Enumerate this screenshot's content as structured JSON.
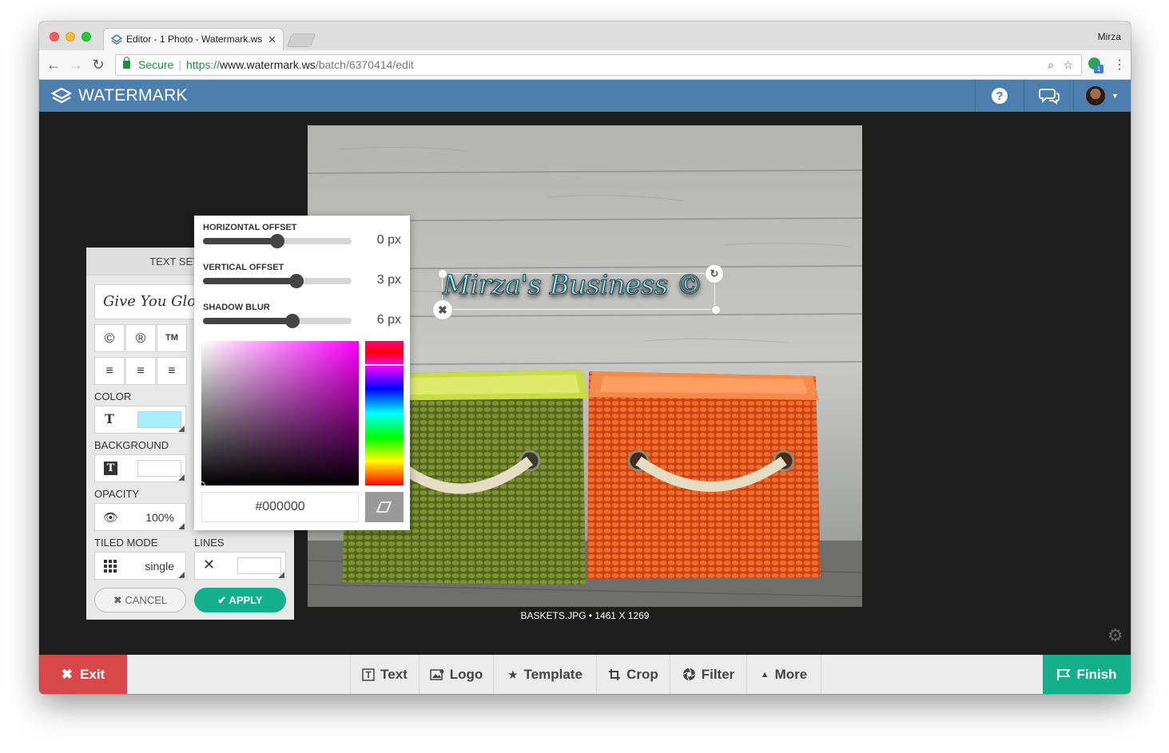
{
  "browser": {
    "tab_title": "Editor - 1 Photo - Watermark.ws",
    "profile_name": "Mirza",
    "secure_label": "Secure",
    "url_protocol": "https://",
    "url_host": "www.watermark.ws",
    "url_path": "/batch/6370414/edit",
    "extension_badge": "1"
  },
  "app": {
    "brand": "WATERMARK",
    "colors": {
      "header": "#4d7fae",
      "accent": "#14b08c",
      "exit": "#d94848"
    }
  },
  "text_settings": {
    "title": "TEXT SETTINGS",
    "preview_text": "Give You Glory",
    "symbols": [
      "©",
      "®",
      "TM"
    ],
    "color_label": "COLOR",
    "text_color": "#a6efff",
    "background_label": "BACKGROUND",
    "background_color": "#ffffff",
    "opacity_label": "OPACITY",
    "opacity_value": "100%",
    "tiled_label": "TILED MODE",
    "tiled_value": "single",
    "lines_label": "LINES",
    "cancel_label": "CANCEL",
    "apply_label": "APPLY"
  },
  "shadow_popup": {
    "horizontal_label": "HORIZONTAL OFFSET",
    "horizontal_value": "0 px",
    "horizontal_level": 0.5,
    "vertical_label": "VERTICAL OFFSET",
    "vertical_value": "3 px",
    "vertical_level": 0.63,
    "blur_label": "SHADOW BLUR",
    "blur_value": "6 px",
    "blur_level": 0.6,
    "hex_value": "#000000"
  },
  "canvas": {
    "watermark_text": "Mirza's Business ©",
    "caption": "BASKETS.JPG • 1461 X 1269"
  },
  "toolbar": {
    "exit_label": "Exit",
    "text_label": "Text",
    "logo_label": "Logo",
    "template_label": "Template",
    "crop_label": "Crop",
    "filter_label": "Filter",
    "more_label": "More",
    "finish_label": "Finish"
  }
}
